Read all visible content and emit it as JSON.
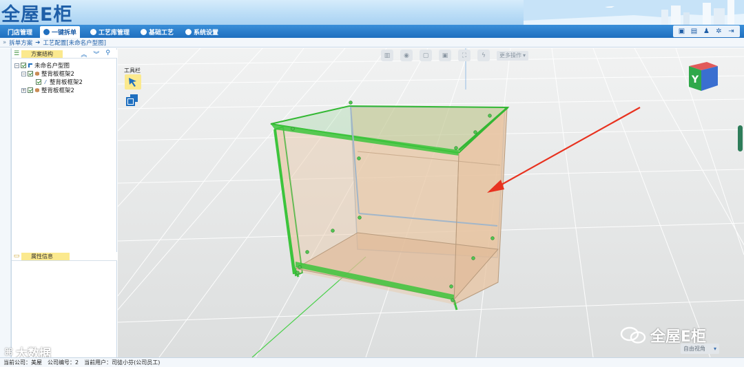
{
  "app": {
    "logo_text": "全屋E柜"
  },
  "nav": {
    "tabs": [
      {
        "label": "门店管理"
      },
      {
        "label": "一键拆单"
      },
      {
        "label": "工艺库管理"
      },
      {
        "label": "基础工艺"
      },
      {
        "label": "系统设置"
      }
    ],
    "active_tab": "一键拆单",
    "right_icons": [
      "monitor-icon",
      "list-icon",
      "user-icon",
      "gear-icon",
      "exit-icon"
    ]
  },
  "breadcrumb": {
    "items": [
      "拆单方案",
      "工艺配置[未命名户型图]"
    ]
  },
  "left_panel": {
    "scheme_title": "方案结构",
    "tree": [
      {
        "label": "未命名户型图",
        "level": 0
      },
      {
        "label": "整背板框架2",
        "level": 1
      },
      {
        "label": "整背板框架2",
        "level": 2
      },
      {
        "label": "整背板框架2",
        "level": 1
      }
    ],
    "props_title": "属性信息"
  },
  "toolbox": {
    "label": "工具栏"
  },
  "viewport_toolbar": {
    "more_label": "更多操作"
  },
  "view_cube": {
    "face_label": "Y"
  },
  "view_mode": {
    "label": "自由视角"
  },
  "watermarks": {
    "right": "全屋E柜",
    "left": "大数据"
  },
  "status": {
    "company_label": "当前公司：美屋",
    "company_no": "公司编号：2",
    "user": "当前用户：司徒小芬(公司员工)"
  },
  "colors": {
    "nav_blue": "#1f6fbf",
    "highlight_green": "#2fbf3a",
    "panel_wood": "#e9c9a8",
    "arrow_red": "#e8321f"
  }
}
